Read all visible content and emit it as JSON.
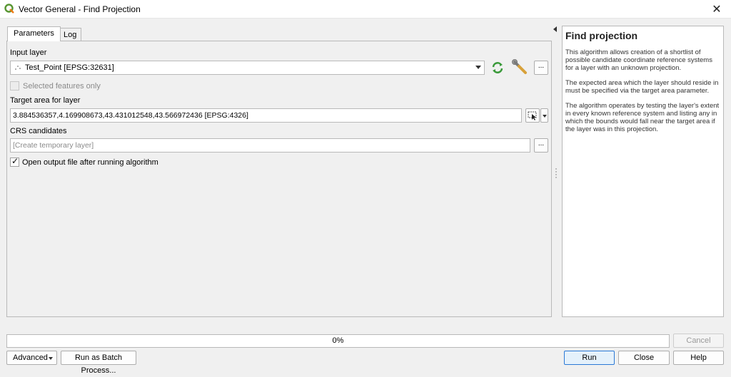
{
  "window": {
    "title": "Vector General - Find Projection",
    "close_glyph": "✕"
  },
  "tabs": [
    {
      "label": "Parameters"
    },
    {
      "label": "Log"
    }
  ],
  "params": {
    "input_layer_label": "Input layer",
    "input_layer_value": "Test_Point [EPSG:32631]",
    "selected_only_label": "Selected features only",
    "target_area_label": "Target area for layer",
    "target_area_value": "3.884536357,4.169908673,43.431012548,43.566972436 [EPSG:4326]",
    "crs_label": "CRS candidates",
    "crs_placeholder": "[Create temporary layer]",
    "open_output_label": "Open output file after running algorithm",
    "dots": "...",
    "checkmark": "✓"
  },
  "help": {
    "title": "Find projection",
    "paragraphs": [
      "This algorithm allows creation of a shortlist of possible candidate coordinate reference systems for a layer with an unknown projection.",
      "The expected area which the layer should reside in must be specified via the target area parameter.",
      "The algorithm operates by testing the layer's extent in every known reference system and listing any in which the bounds would fall near the target area if the layer was in this projection."
    ]
  },
  "progress": {
    "value": 0,
    "label": "0%"
  },
  "buttons": {
    "cancel": "Cancel",
    "advanced": "Advanced",
    "batch": "Run as Batch Process...",
    "run": "Run",
    "close": "Close",
    "help": "Help"
  },
  "icons": {
    "app": "qgis-logo-icon",
    "point_layer": "point-layer-icon",
    "iterate": "iterate-refresh-icon",
    "settings": "wrench-icon",
    "extent": "map-extent-cursor-icon"
  },
  "colors": {
    "accent": "#2b79d6",
    "qgis_green": "#589632",
    "iterate_green": "#3a9a3a"
  }
}
